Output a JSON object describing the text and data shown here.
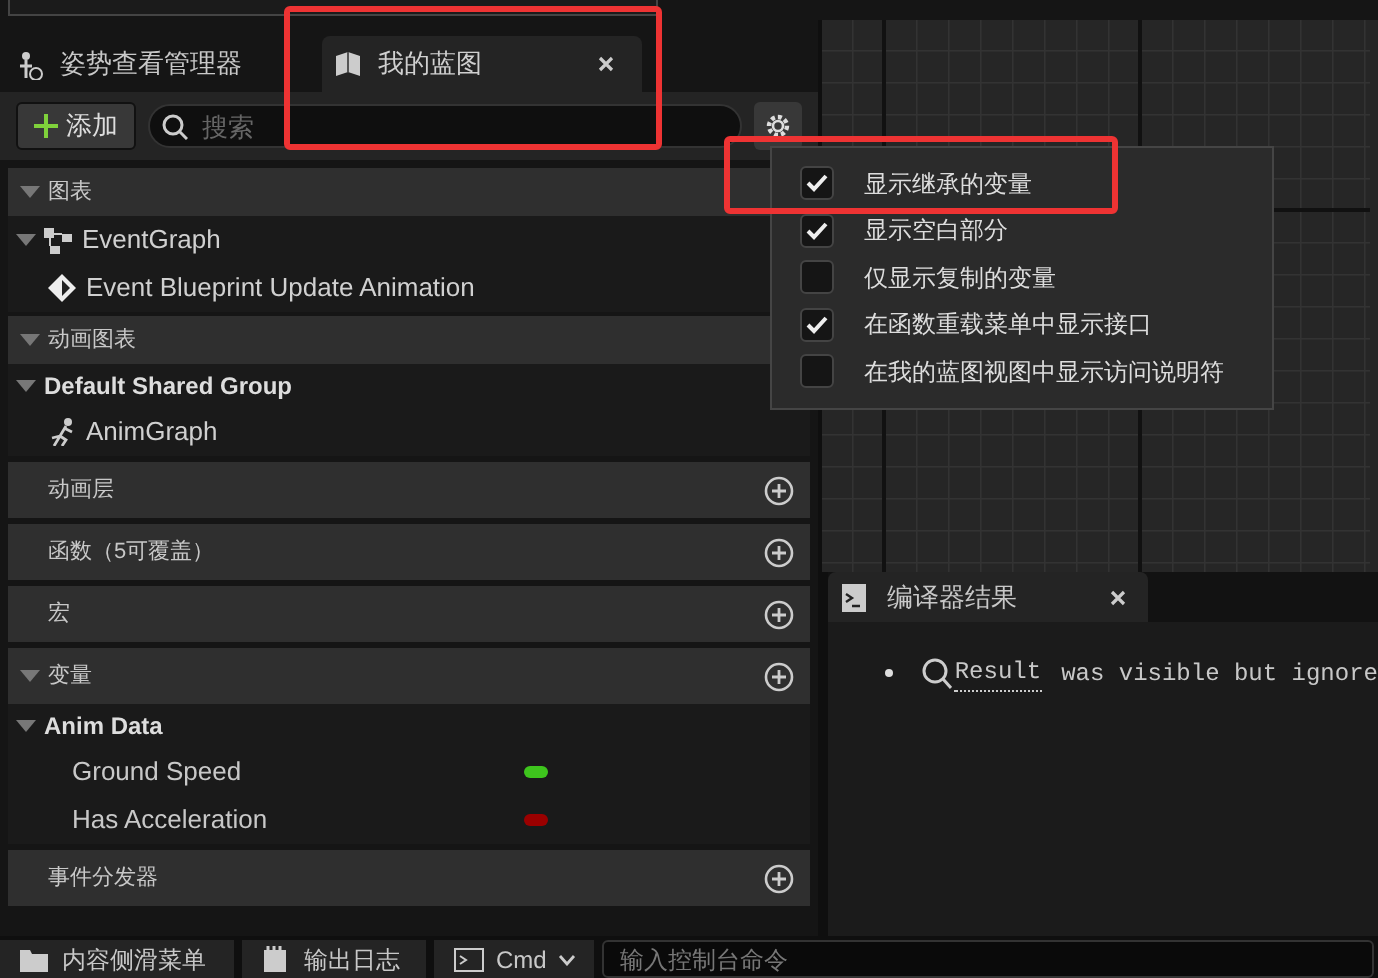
{
  "tabs": [
    {
      "label": "姿势查看管理器",
      "selected": false,
      "kind": "pose",
      "closable": false,
      "highlighted": false
    },
    {
      "label": "我的蓝图",
      "selected": true,
      "kind": "book",
      "closable": true,
      "highlighted": true
    }
  ],
  "toolbar": {
    "add_label": "添加",
    "search": {
      "placeholder": "搜索"
    }
  },
  "sections": [
    {
      "label": "图表",
      "expanded": true,
      "addable": false,
      "children": [
        {
          "label": "EventGraph",
          "kind": "graph",
          "expanded": true,
          "children": [
            {
              "label": "Event Blueprint Update Animation",
              "kind": "event"
            }
          ]
        }
      ]
    },
    {
      "label": "动画图表",
      "expanded": true,
      "addable": false,
      "children": [
        {
          "label": "Default Shared Group",
          "kind": "group",
          "expanded": true,
          "children": [
            {
              "label": "AnimGraph",
              "kind": "anim"
            }
          ]
        }
      ]
    },
    {
      "label": "动画层",
      "addable": true
    },
    {
      "label": "函数（5可覆盖）",
      "addable": true
    },
    {
      "label": "宏",
      "addable": true
    },
    {
      "label": "变量",
      "expanded": true,
      "addable": true,
      "children": [
        {
          "label": "Anim Data",
          "kind": "group",
          "expanded": true,
          "children": [
            {
              "label": "Ground Speed",
              "kind": "variable",
              "color": "#3ec51d"
            },
            {
              "label": "Has Acceleration",
              "kind": "variable",
              "color": "#9b0000"
            }
          ]
        }
      ]
    },
    {
      "label": "事件分发器",
      "addable": true
    }
  ],
  "settings_menu": [
    {
      "label": "显示继承的变量",
      "checked": true,
      "highlighted": true
    },
    {
      "label": "显示空白部分",
      "checked": true,
      "highlighted": false
    },
    {
      "label": "仅显示复制的变量",
      "checked": false,
      "highlighted": false
    },
    {
      "label": "在函数重载菜单中显示接口",
      "checked": true,
      "highlighted": false
    },
    {
      "label": "在我的蓝图视图中显示访问说明符",
      "checked": false,
      "highlighted": false
    }
  ],
  "compiler_results": {
    "title": "编译器结果",
    "messages": [
      {
        "link": "Result",
        "text": "was visible but ignore"
      }
    ]
  },
  "status_bar": {
    "items": [
      {
        "label": "内容侧滑菜单",
        "kind": "folder"
      },
      {
        "label": "输出日志",
        "kind": "log"
      },
      {
        "label": "Cmd",
        "kind": "cmd"
      }
    ],
    "console": {
      "placeholder": "输入控制台命令"
    }
  }
}
